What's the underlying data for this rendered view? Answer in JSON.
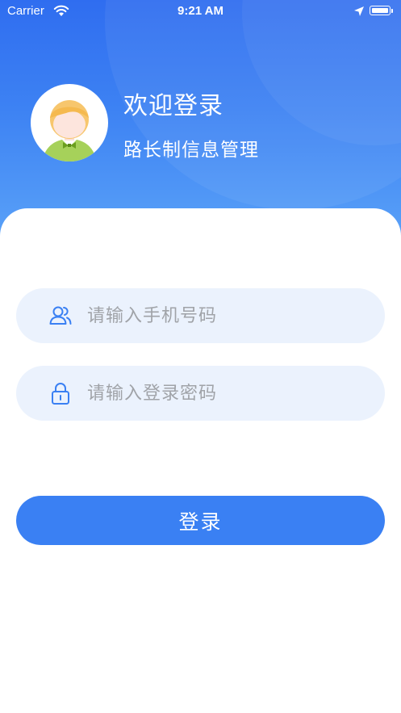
{
  "status_bar": {
    "carrier": "Carrier",
    "time": "9:21 AM"
  },
  "header": {
    "welcome": "欢迎登录",
    "subtitle": "路长制信息管理"
  },
  "form": {
    "phone_placeholder": "请输入手机号码",
    "password_placeholder": "请输入登录密码",
    "login_label": "登录"
  },
  "icons": {
    "phone_field": "users-icon",
    "password_field": "lock-icon",
    "avatar": "avatar-illustration"
  },
  "colors": {
    "header_top": "#2f6df0",
    "header_bottom": "#5aa2f8",
    "accent": "#3a80f3",
    "field_bg": "#ebf2fd",
    "placeholder": "#a0a3a8"
  }
}
